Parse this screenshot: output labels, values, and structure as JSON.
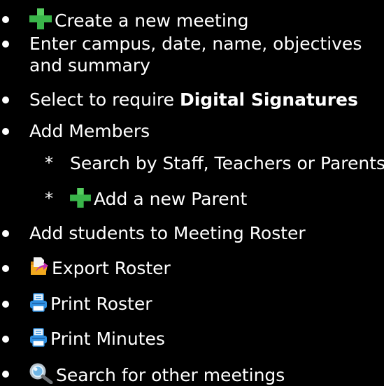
{
  "items": [
    {
      "text": "Create a new meeting",
      "icon": "plus-icon"
    },
    {
      "text": "Enter campus, date, name, objectives and summary"
    },
    {
      "text_prefix": "Select to require ",
      "text_bold": "Digital Signatures"
    },
    {
      "text": "Add Members"
    },
    {
      "text": "Search by Staff, Teachers or Parents",
      "sub": true
    },
    {
      "text": "Add a new Parent",
      "icon": "plus-icon",
      "sub": true
    },
    {
      "text": "Add students to Meeting Roster"
    },
    {
      "text": "Export Roster",
      "icon": "export-folder-icon"
    },
    {
      "text": "Print Roster",
      "icon": "printer-icon"
    },
    {
      "text": "Print Minutes",
      "icon": "printer-icon"
    },
    {
      "text": "Search for other meetings",
      "icon": "magnifier-icon"
    }
  ],
  "sub_marker": "*",
  "colors": {
    "background": "#000000",
    "text": "#ffffff",
    "plus": "#3ab54a",
    "printer": "#2f8fe0",
    "folder": "#f2a91f",
    "export_arrow": "#c42fb0",
    "magnifier": "#4aa3df"
  }
}
